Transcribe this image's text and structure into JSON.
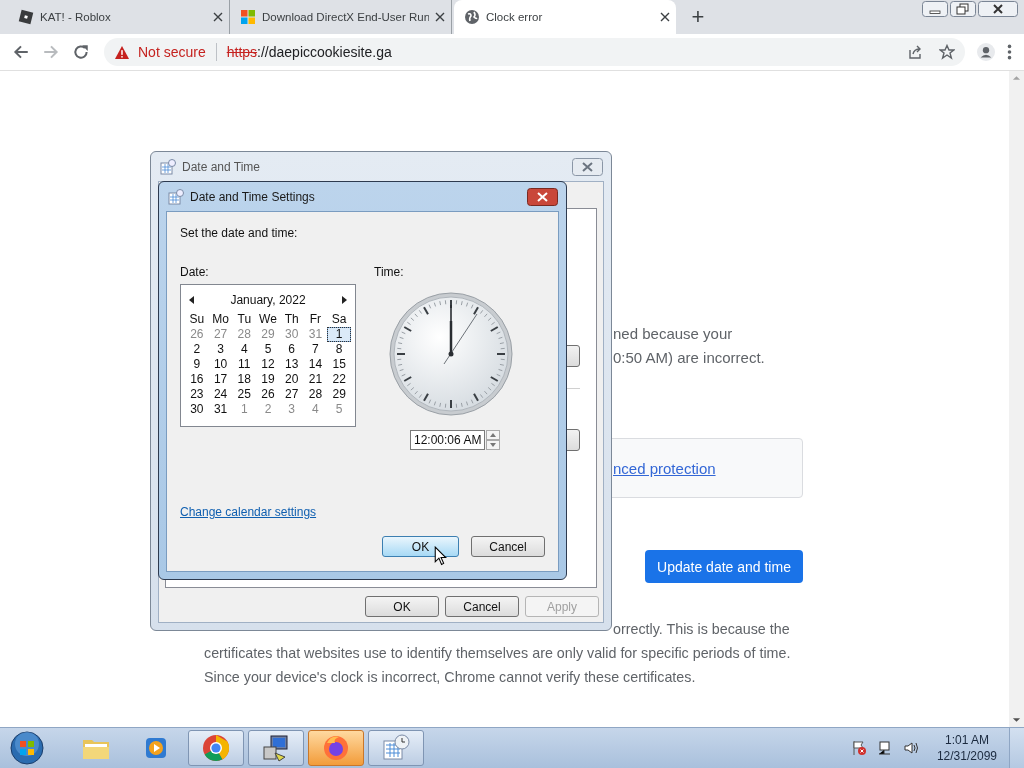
{
  "browser": {
    "tabs": [
      {
        "kind": "roblox",
        "title": "KAT! - Roblox",
        "selected": false
      },
      {
        "kind": "windows",
        "title": "Download DirectX End-User Run",
        "selected": false
      },
      {
        "kind": "globe",
        "title": "Clock error",
        "selected": true
      }
    ],
    "new_tab": "+",
    "address": {
      "security": "Not secure",
      "scheme": "https",
      "rest": "://daepiccookiesite.ga"
    }
  },
  "page": {
    "reason_lines": [
      "ned because your",
      "0:50 AM) are incorrect."
    ],
    "card_link": "nced protection",
    "update_button": "Update date and time",
    "explanation": "orrectly. This is because the certificates that websites use to identify themselves are only valid for specific periods of time. Since your device's clock is incorrect, Chrome cannot verify these certificates."
  },
  "outer_dialog": {
    "title": "Date and Time",
    "buttons": [
      {
        "label": "OK",
        "disabled": false
      },
      {
        "label": "Cancel",
        "disabled": false
      },
      {
        "label": "Apply",
        "disabled": true
      }
    ]
  },
  "settings_dialog": {
    "title": "Date and Time Settings",
    "prompt": "Set the date and time:",
    "date_label": "Date:",
    "time_label": "Time:",
    "calendar": {
      "month": "January, 2022",
      "weekdays": [
        "Su",
        "Mo",
        "Tu",
        "We",
        "Th",
        "Fr",
        "Sa"
      ],
      "weeks": [
        [
          {
            "day": "26",
            "other": true,
            "selected": false
          },
          {
            "day": "27",
            "other": true,
            "selected": false
          },
          {
            "day": "28",
            "other": true,
            "selected": false
          },
          {
            "day": "29",
            "other": true,
            "selected": false
          },
          {
            "day": "30",
            "other": true,
            "selected": false
          },
          {
            "day": "31",
            "other": true,
            "selected": false
          },
          {
            "day": "1",
            "other": false,
            "selected": true
          }
        ],
        [
          {
            "day": "2",
            "other": false,
            "selected": false
          },
          {
            "day": "3",
            "other": false,
            "selected": false
          },
          {
            "day": "4",
            "other": false,
            "selected": false
          },
          {
            "day": "5",
            "other": false,
            "selected": false
          },
          {
            "day": "6",
            "other": false,
            "selected": false
          },
          {
            "day": "7",
            "other": false,
            "selected": false
          },
          {
            "day": "8",
            "other": false,
            "selected": false
          }
        ],
        [
          {
            "day": "9",
            "other": false,
            "selected": false
          },
          {
            "day": "10",
            "other": false,
            "selected": false
          },
          {
            "day": "11",
            "other": false,
            "selected": false
          },
          {
            "day": "12",
            "other": false,
            "selected": false
          },
          {
            "day": "13",
            "other": false,
            "selected": false
          },
          {
            "day": "14",
            "other": false,
            "selected": false
          },
          {
            "day": "15",
            "other": false,
            "selected": false
          }
        ],
        [
          {
            "day": "16",
            "other": false,
            "selected": false
          },
          {
            "day": "17",
            "other": false,
            "selected": false
          },
          {
            "day": "18",
            "other": false,
            "selected": false
          },
          {
            "day": "19",
            "other": false,
            "selected": false
          },
          {
            "day": "20",
            "other": false,
            "selected": false
          },
          {
            "day": "21",
            "other": false,
            "selected": false
          },
          {
            "day": "22",
            "other": false,
            "selected": false
          }
        ],
        [
          {
            "day": "23",
            "other": false,
            "selected": false
          },
          {
            "day": "24",
            "other": false,
            "selected": false
          },
          {
            "day": "25",
            "other": false,
            "selected": false
          },
          {
            "day": "26",
            "other": false,
            "selected": false
          },
          {
            "day": "27",
            "other": false,
            "selected": false
          },
          {
            "day": "28",
            "other": false,
            "selected": false
          },
          {
            "day": "29",
            "other": false,
            "selected": false
          }
        ],
        [
          {
            "day": "30",
            "other": false,
            "selected": false
          },
          {
            "day": "31",
            "other": false,
            "selected": false
          },
          {
            "day": "1",
            "other": true,
            "selected": false
          },
          {
            "day": "2",
            "other": true,
            "selected": false
          },
          {
            "day": "3",
            "other": true,
            "selected": false
          },
          {
            "day": "4",
            "other": true,
            "selected": false
          },
          {
            "day": "5",
            "other": true,
            "selected": false
          }
        ]
      ]
    },
    "time_value": "12:00:06 AM",
    "link": "Change calendar settings",
    "buttons": [
      {
        "label": "OK",
        "focused": true
      },
      {
        "label": "Cancel",
        "focused": false
      }
    ]
  },
  "taskbar": {
    "items": [
      {
        "kind": "folder",
        "running": false,
        "highlighted": false
      },
      {
        "kind": "media",
        "running": false,
        "highlighted": false
      },
      {
        "kind": "chrome",
        "running": true,
        "highlighted": false
      },
      {
        "kind": "computer",
        "running": true,
        "highlighted": false
      },
      {
        "kind": "firefox",
        "running": true,
        "highlighted": true
      },
      {
        "kind": "datetime",
        "running": true,
        "highlighted": false
      }
    ],
    "time": "1:01 AM",
    "date": "12/31/2099"
  }
}
